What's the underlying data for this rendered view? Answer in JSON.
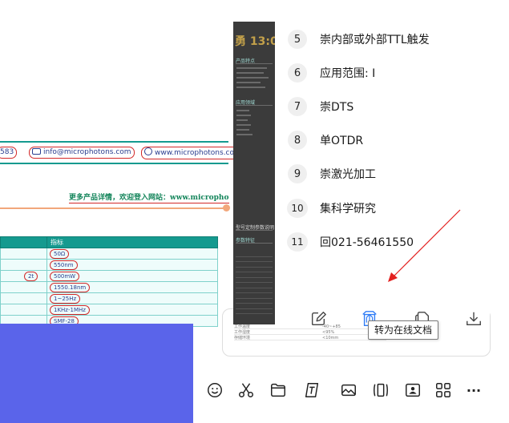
{
  "document_preview": {
    "contact_phone_fragment": "583",
    "contact_email": "info@microphotons.com",
    "contact_web": "www.microphotons.com",
    "promo_text": "更多产品详情，欢迎登入网站：www.microphotons.co",
    "table_header": "指标",
    "table_values": [
      "50Ω",
      "550nm",
      "2t",
      "500mW",
      "1550.18nm",
      "1~25Hz",
      "1KHz-1MHz",
      "SMF-28"
    ]
  },
  "thumbnail": {
    "title_fragment": "勇 13:0",
    "section_1": "产品特点",
    "section_2": "应用领域",
    "section_3": "参数特征",
    "bar_title": "型号定制参数说明"
  },
  "lower_card": {
    "rows": [
      {
        "label": "工作温度",
        "value": "-40~+85"
      },
      {
        "label": "工作湿度",
        "value": "<95%"
      },
      {
        "label": "存储环境",
        "value": "<10mm"
      }
    ]
  },
  "menu": {
    "items": [
      {
        "num": "5",
        "label": "崇内部或外部TTL触发"
      },
      {
        "num": "6",
        "label": "应用范围: I"
      },
      {
        "num": "7",
        "label": "崇DTS"
      },
      {
        "num": "8",
        "label": "单OTDR"
      },
      {
        "num": "9",
        "label": "崇激光加工"
      },
      {
        "num": "10",
        "label": "集科学研究"
      },
      {
        "num": "11",
        "label": "回021-56461550"
      }
    ],
    "icons": [
      "edit-icon",
      "convert-online-doc-icon",
      "copy-icon",
      "download-icon"
    ]
  },
  "tooltip": {
    "text": "转为在线文档"
  },
  "toolbar": {
    "icons": [
      "emoji-icon",
      "scissors-icon",
      "folder-icon",
      "text-box-icon",
      "image-icon",
      "clip-icon",
      "screen-share-icon",
      "apps-grid-icon",
      "more-icon"
    ],
    "more_label": "···"
  },
  "colors": {
    "accent_blue": "#2f7cf6",
    "annotation_red": "#e3201f",
    "table_teal": "#159a8f",
    "blue_block": "#5a64ea"
  }
}
